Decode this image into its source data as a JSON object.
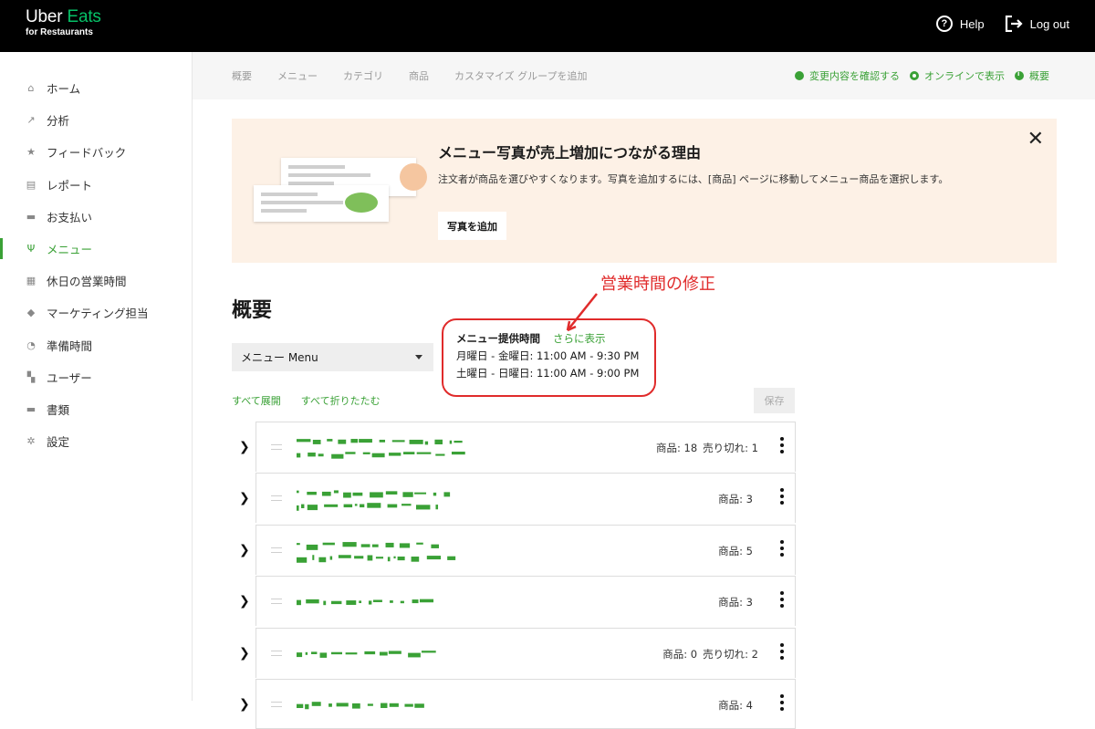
{
  "topbar": {
    "logo_line1_uber": "Uber",
    "logo_line1_eats": "Eats",
    "logo_line2": "for Restaurants",
    "help_label": "Help",
    "logout_label": "Log out"
  },
  "sidebar": {
    "items": [
      {
        "label": "ホーム",
        "icon": "home-icon",
        "active": false
      },
      {
        "label": "分析",
        "icon": "chart-icon",
        "active": false
      },
      {
        "label": "フィードバック",
        "icon": "star-icon",
        "active": false
      },
      {
        "label": "レポート",
        "icon": "report-icon",
        "active": false
      },
      {
        "label": "お支払い",
        "icon": "payment-icon",
        "active": false
      },
      {
        "label": "メニュー",
        "icon": "fork-icon",
        "active": true
      },
      {
        "label": "休日の営業時間",
        "icon": "calendar-icon",
        "active": false
      },
      {
        "label": "マーケティング担当",
        "icon": "tag-icon",
        "active": false
      },
      {
        "label": "準備時間",
        "icon": "timer-icon",
        "active": false
      },
      {
        "label": "ユーザー",
        "icon": "users-icon",
        "active": false
      },
      {
        "label": "書類",
        "icon": "folder-icon",
        "active": false
      },
      {
        "label": "設定",
        "icon": "gear-icon",
        "active": false
      }
    ]
  },
  "subnav": {
    "tabs": [
      "概要",
      "メニュー",
      "カテゴリ",
      "商品",
      "カスタマイズ グループを追加"
    ],
    "review_changes": "変更内容を確認する",
    "show_online": "オンラインで表示",
    "overview": "概要"
  },
  "banner": {
    "title": "メニュー写真が売上増加につながる理由",
    "description": "注文者が商品を選びやすくなります。写真を追加するには、[商品] ページに移動してメニュー商品を選択します。",
    "button_label": "写真を追加",
    "close_label": "✕"
  },
  "overview": {
    "title": "概要",
    "menu_select_value": "メニュー Menu",
    "hours_label": "メニュー提供時間",
    "hours_more": "さらに表示",
    "hours_rows": [
      "月曜日 - 金曜日: 11:00 AM - 9:30 PM",
      "土曜日 - 日曜日: 11:00 AM - 9:00 PM"
    ],
    "expand_all": "すべて展開",
    "collapse_all": "すべて折りたたむ",
    "save_label": "保存"
  },
  "annotation": {
    "text": "営業時間の修正",
    "color": "#e02b2b"
  },
  "categories": [
    {
      "items": "商品: 18",
      "sold_out": "売り切れ: 1"
    },
    {
      "items": "商品: 3",
      "sold_out": ""
    },
    {
      "items": "商品: 5",
      "sold_out": ""
    },
    {
      "items": "商品: 3",
      "sold_out": ""
    },
    {
      "items": "商品: 0",
      "sold_out": "売り切れ: 2"
    },
    {
      "items": "商品: 4",
      "sold_out": ""
    }
  ],
  "colors": {
    "accent": "#3aa136",
    "topbar": "#000000",
    "banner": "#fdf1e6"
  }
}
